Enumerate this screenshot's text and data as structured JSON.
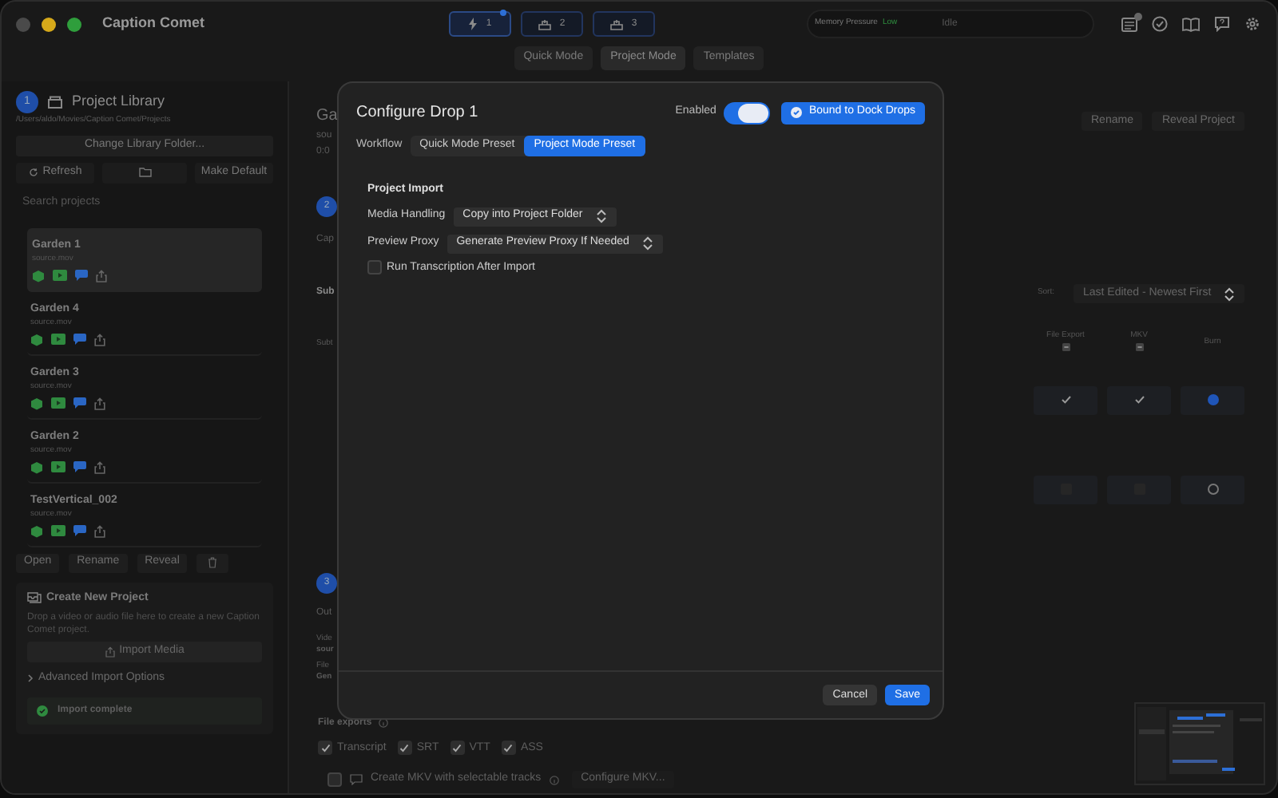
{
  "window": {
    "title": "Caption Comet"
  },
  "drop_slots": [
    {
      "label": "1",
      "kind": "bolt",
      "selected": true
    },
    {
      "label": "2",
      "kind": "tray",
      "selected": false
    },
    {
      "label": "3",
      "kind": "tray",
      "selected": false
    }
  ],
  "status": {
    "label": "Memory Pressure",
    "pressure": "Low",
    "state": "Idle"
  },
  "mode_tabs": [
    {
      "label": "Quick Mode",
      "selected": false
    },
    {
      "label": "Project Mode",
      "selected": true
    },
    {
      "label": "Templates",
      "selected": false
    }
  ],
  "sidebar": {
    "step": "1",
    "title": "Project Library",
    "path": "/Users/aldo/Movies/Caption Comet/Projects",
    "change_folder": "Change Library Folder...",
    "refresh": "Refresh",
    "make_default": "Make Default",
    "search": {
      "placeholder": "Search projects"
    },
    "projects": [
      {
        "name": "Garden 1",
        "file": "source.mov",
        "selected": true
      },
      {
        "name": "Garden 4",
        "file": "source.mov",
        "selected": false
      },
      {
        "name": "Garden 3",
        "file": "source.mov",
        "selected": false
      },
      {
        "name": "Garden 2",
        "file": "source.mov",
        "selected": false
      },
      {
        "name": "TestVertical_002",
        "file": "source.mov",
        "selected": false
      }
    ],
    "actions": [
      "Open",
      "Rename",
      "Reveal"
    ],
    "create": {
      "title": "Create New Project",
      "description": "Drop a video or audio file here to create a new Caption Comet project.",
      "import_button": "Import Media",
      "advanced": "Advanced Import Options",
      "advanced_expanded": false,
      "status": "Import complete"
    }
  },
  "main": {
    "fragments_top": [
      "Ga",
      "sou",
      "0:0"
    ],
    "step_2": "2",
    "fragments_mid": [
      "Cap",
      "Sub",
      "Subt"
    ],
    "step_3": "3",
    "fragments_low": [
      "Out",
      "Vide",
      "sour",
      "File",
      "Gen"
    ],
    "rename": "Rename",
    "reveal_project": "Reveal Project",
    "sort_label": "Sort:",
    "sort_value": "Last Edited - Newest First",
    "columns": [
      "File Export",
      "MKV",
      "Burn"
    ],
    "rows": [
      {
        "file_export": true,
        "mkv": true,
        "burn": true
      },
      {
        "file_export": false,
        "mkv": false,
        "burn": false
      }
    ],
    "file_exports_label": "File exports",
    "exports": [
      {
        "label": "Transcript",
        "checked": true
      },
      {
        "label": "SRT",
        "checked": true
      },
      {
        "label": "VTT",
        "checked": true
      },
      {
        "label": "ASS",
        "checked": true
      }
    ],
    "mkv": {
      "label": "Create MKV with selectable tracks",
      "checked": false,
      "configure": "Configure MKV..."
    }
  },
  "dialog": {
    "title": "Configure Drop 1",
    "enabled_label": "Enabled",
    "enabled": true,
    "bound": "Bound to Dock Drops",
    "workflow_label": "Workflow",
    "workflows": [
      {
        "label": "Quick Mode Preset",
        "selected": false
      },
      {
        "label": "Project Mode Preset",
        "selected": true
      }
    ],
    "section": "Project Import",
    "fields": [
      {
        "label": "Media Handling",
        "value": "Copy into Project Folder"
      },
      {
        "label": "Preview Proxy",
        "value": "Generate Preview Proxy If Needed"
      }
    ],
    "run_transcription": {
      "label": "Run Transcription After Import",
      "checked": false
    },
    "cancel": "Cancel",
    "save": "Save"
  }
}
